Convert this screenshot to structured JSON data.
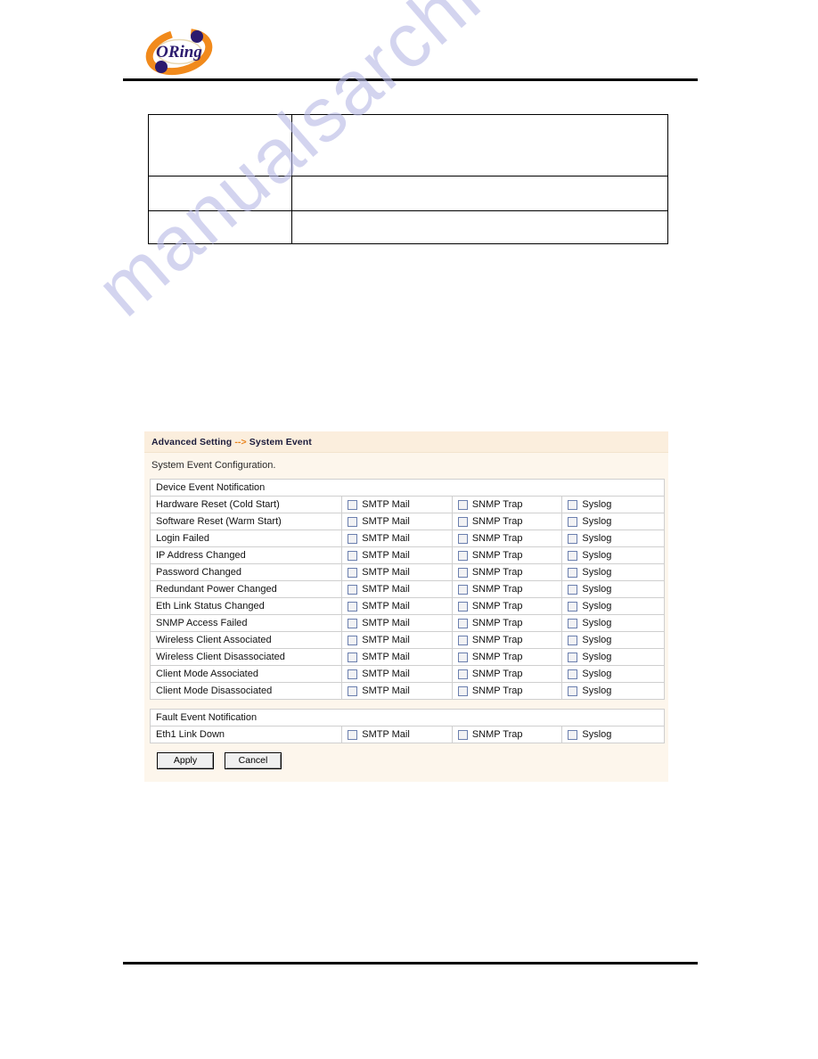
{
  "brand": {
    "logo_text": "ORing",
    "logo_ring_color": "#f18a1c",
    "logo_dot_color": "#2b1a6e"
  },
  "spec_table": {
    "rows": [
      {
        "label": "",
        "value": ""
      },
      {
        "label": "",
        "value": ""
      },
      {
        "label": "",
        "value": ""
      }
    ]
  },
  "watermark": {
    "text": "manualsarchive.com"
  },
  "panel": {
    "breadcrumb_prefix": "Advanced Setting",
    "breadcrumb_separator": "-->",
    "breadcrumb_page": "System Event",
    "description": "System Event Configuration.",
    "columns": [
      "SMTP Mail",
      "SNMP Trap",
      "Syslog"
    ],
    "device_section_title": "Device Event Notification",
    "device_events": [
      "Hardware Reset (Cold Start)",
      "Software Reset (Warm Start)",
      "Login Failed",
      "IP Address Changed",
      "Password Changed",
      "Redundant Power Changed",
      "Eth Link Status Changed",
      "SNMP Access Failed",
      "Wireless Client Associated",
      "Wireless Client Disassociated",
      "Client Mode Associated",
      "Client Mode Disassociated"
    ],
    "fault_section_title": "Fault Event Notification",
    "fault_events": [
      "Eth1 Link Down"
    ],
    "buttons": {
      "apply": "Apply",
      "cancel": "Cancel"
    },
    "accent_color": "#e8821a",
    "panel_bg": "#fdf6ec"
  }
}
